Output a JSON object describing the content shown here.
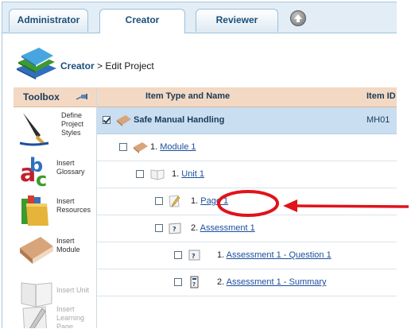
{
  "tabs": [
    {
      "label": "Administrator",
      "active": false
    },
    {
      "label": "Creator",
      "active": true
    },
    {
      "label": "Reviewer",
      "active": false
    }
  ],
  "breadcrumb": {
    "current": "Creator",
    "separator": ">",
    "page": "Edit Project"
  },
  "toolbox": {
    "title": "Toolbox",
    "items": [
      {
        "label": "Define Project Styles",
        "icon": "pen-nib-icon",
        "enabled": true
      },
      {
        "label": "Insert Glossary",
        "icon": "abc-letters-icon",
        "enabled": true
      },
      {
        "label": "Insert Resources",
        "icon": "folder-icon",
        "enabled": true
      },
      {
        "label": "Insert Module",
        "icon": "book-icon",
        "enabled": true
      },
      {
        "label": "Insert Unit",
        "icon": "open-book-icon",
        "enabled": false
      },
      {
        "label": "Insert Learning Page",
        "icon": "pencil-page-icon",
        "enabled": false
      }
    ]
  },
  "grid": {
    "columns": [
      "Item Type and Name",
      "Item ID"
    ],
    "rows": [
      {
        "level": 0,
        "checked": true,
        "selected": true,
        "icon": "book-icon",
        "number": "",
        "name": "Safe Manual Handling",
        "id": "MH01"
      },
      {
        "level": 1,
        "checked": false,
        "selected": false,
        "icon": "book-icon",
        "number": "1.",
        "name": "Module 1",
        "id": ""
      },
      {
        "level": 2,
        "checked": false,
        "selected": false,
        "icon": "open-book-icon",
        "number": "1.",
        "name": "Unit 1",
        "id": ""
      },
      {
        "level": 3,
        "checked": false,
        "selected": false,
        "icon": "pencil-page-icon",
        "number": "1.",
        "name": "Page 1",
        "id": ""
      },
      {
        "level": 3,
        "checked": false,
        "selected": false,
        "icon": "assessment-icon",
        "number": "2.",
        "name": "Assessment 1",
        "id": ""
      },
      {
        "level": 4,
        "checked": false,
        "selected": false,
        "icon": "question-icon",
        "number": "1.",
        "name": "Assessment 1 - Question 1",
        "id": ""
      },
      {
        "level": 4,
        "checked": false,
        "selected": false,
        "icon": "summary-icon",
        "number": "2.",
        "name": "Assessment 1 - Summary",
        "id": ""
      }
    ]
  },
  "colors": {
    "accent": "#1b4e9b",
    "annotation": "#e0131b",
    "header_bg": "#f3d9c3",
    "selected_row": "#c9def0"
  }
}
